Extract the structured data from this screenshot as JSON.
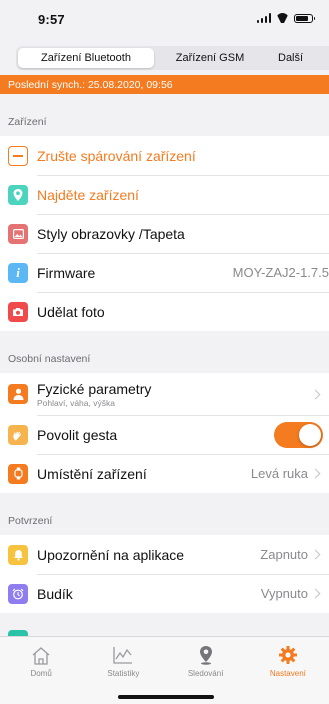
{
  "status_bar": {
    "time": "9:57"
  },
  "tabs": [
    {
      "label": "Zařízení Bluetooth",
      "active": true
    },
    {
      "label": "Zařízení GSM",
      "active": false
    },
    {
      "label": "Další",
      "active": false
    }
  ],
  "sync_text": "Poslední synch.: 25.08.2020, 09:56",
  "sections": {
    "device": {
      "title": "Zařízení",
      "items": [
        {
          "label": "Zrušte spárování zařízení",
          "icon": "unpair-icon",
          "color": "#f47b20"
        },
        {
          "label": "Najděte zařízení",
          "icon": "location-pin-icon",
          "color": "#4cd4be"
        },
        {
          "label": "Styly obrazovky /Tapeta",
          "icon": "image-icon",
          "color": "#e57373"
        },
        {
          "label": "Firmware",
          "value": "MOY-ZAJ2-1.7.5",
          "icon": "info-icon",
          "color": "#5bb8f5"
        },
        {
          "label": "Udělat foto",
          "icon": "camera-icon",
          "color": "#f04a4a"
        }
      ]
    },
    "personal": {
      "title": "Osobní nastavení",
      "items": [
        {
          "label": "Fyzické parametry",
          "sublabel": "Pohlaví, váha, výška",
          "icon": "person-icon",
          "color": "#f47b20"
        },
        {
          "label": "Povolit gesta",
          "toggle": true,
          "icon": "gesture-icon",
          "color": "#f7b34d"
        },
        {
          "label": "Umístění zařízení",
          "value": "Levá ruka",
          "icon": "wrist-icon",
          "color": "#f47b20"
        }
      ]
    },
    "confirm": {
      "title": "Potvrzení",
      "items": [
        {
          "label": "Upozornění na aplikace",
          "value": "Zapnuto",
          "icon": "bell-icon",
          "color": "#f7c23d"
        },
        {
          "label": "Budík",
          "value": "Vypnuto",
          "icon": "alarm-clock-icon",
          "color": "#8e7cf0"
        }
      ]
    }
  },
  "tabbar": [
    {
      "label": "Domů",
      "icon": "home-icon",
      "active": false
    },
    {
      "label": "Statistiky",
      "icon": "chart-icon",
      "active": false
    },
    {
      "label": "Sledování",
      "icon": "map-pin-icon",
      "active": false
    },
    {
      "label": "Nastavení",
      "icon": "gear-icon",
      "active": true
    }
  ],
  "colors": {
    "accent": "#f47b20",
    "background": "#f2f2f4"
  }
}
